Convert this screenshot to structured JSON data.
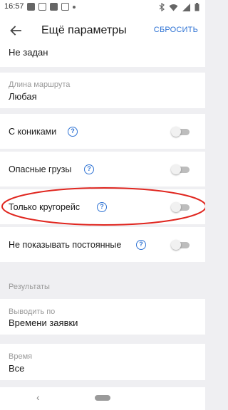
{
  "status_bar": {
    "time": "16:57"
  },
  "app_bar": {
    "title": "Ещё параметры",
    "reset_label": "СБРОСИТЬ"
  },
  "settings": {
    "partial_value": "Не задан",
    "route_length": {
      "caption": "Длина маршрута",
      "value": "Любая"
    },
    "toggles": [
      {
        "label": "С кониками",
        "on": false
      },
      {
        "label": "Опасные грузы",
        "on": false
      },
      {
        "label": "Только кругорейс",
        "on": false
      },
      {
        "label": "Не показывать постоянные",
        "on": false
      }
    ],
    "help_glyph": "?"
  },
  "results": {
    "header": "Результаты",
    "sort_by": {
      "caption": "Выводить по",
      "value": "Времени заявки"
    },
    "time": {
      "caption": "Время",
      "value": "Все"
    }
  },
  "nav_bar": {
    "back_glyph": "‹"
  },
  "colors": {
    "accent": "#2f73d4",
    "highlight": "#e0261f",
    "background": "#efeff2"
  }
}
